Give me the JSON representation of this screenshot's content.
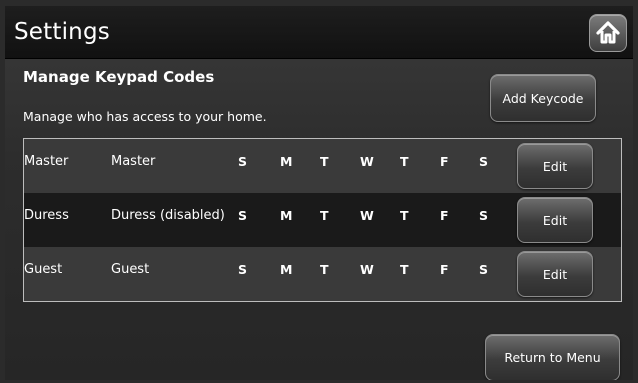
{
  "header": {
    "title": "Settings",
    "home_icon": "home-icon"
  },
  "section": {
    "title": "Manage Keypad Codes",
    "subtitle": "Manage who has access to your home."
  },
  "actions": {
    "add_label": "Add Keycode",
    "return_label": "Return to Menu"
  },
  "codes": [
    {
      "type": "Master",
      "name": "Master",
      "days": [
        "S",
        "M",
        "T",
        "W",
        "T",
        "F",
        "S"
      ],
      "edit_label": "Edit"
    },
    {
      "type": "Duress",
      "name": "Duress (disabled)",
      "days": [
        "S",
        "M",
        "T",
        "W",
        "T",
        "F",
        "S"
      ],
      "edit_label": "Edit"
    },
    {
      "type": "Guest",
      "name": "Guest",
      "days": [
        "S",
        "M",
        "T",
        "W",
        "T",
        "F",
        "S"
      ],
      "edit_label": "Edit"
    }
  ],
  "colors": {
    "background": "#2d2d2d",
    "header": "#111111",
    "row_alt": "#1a1a1a",
    "text": "#ffffff"
  }
}
